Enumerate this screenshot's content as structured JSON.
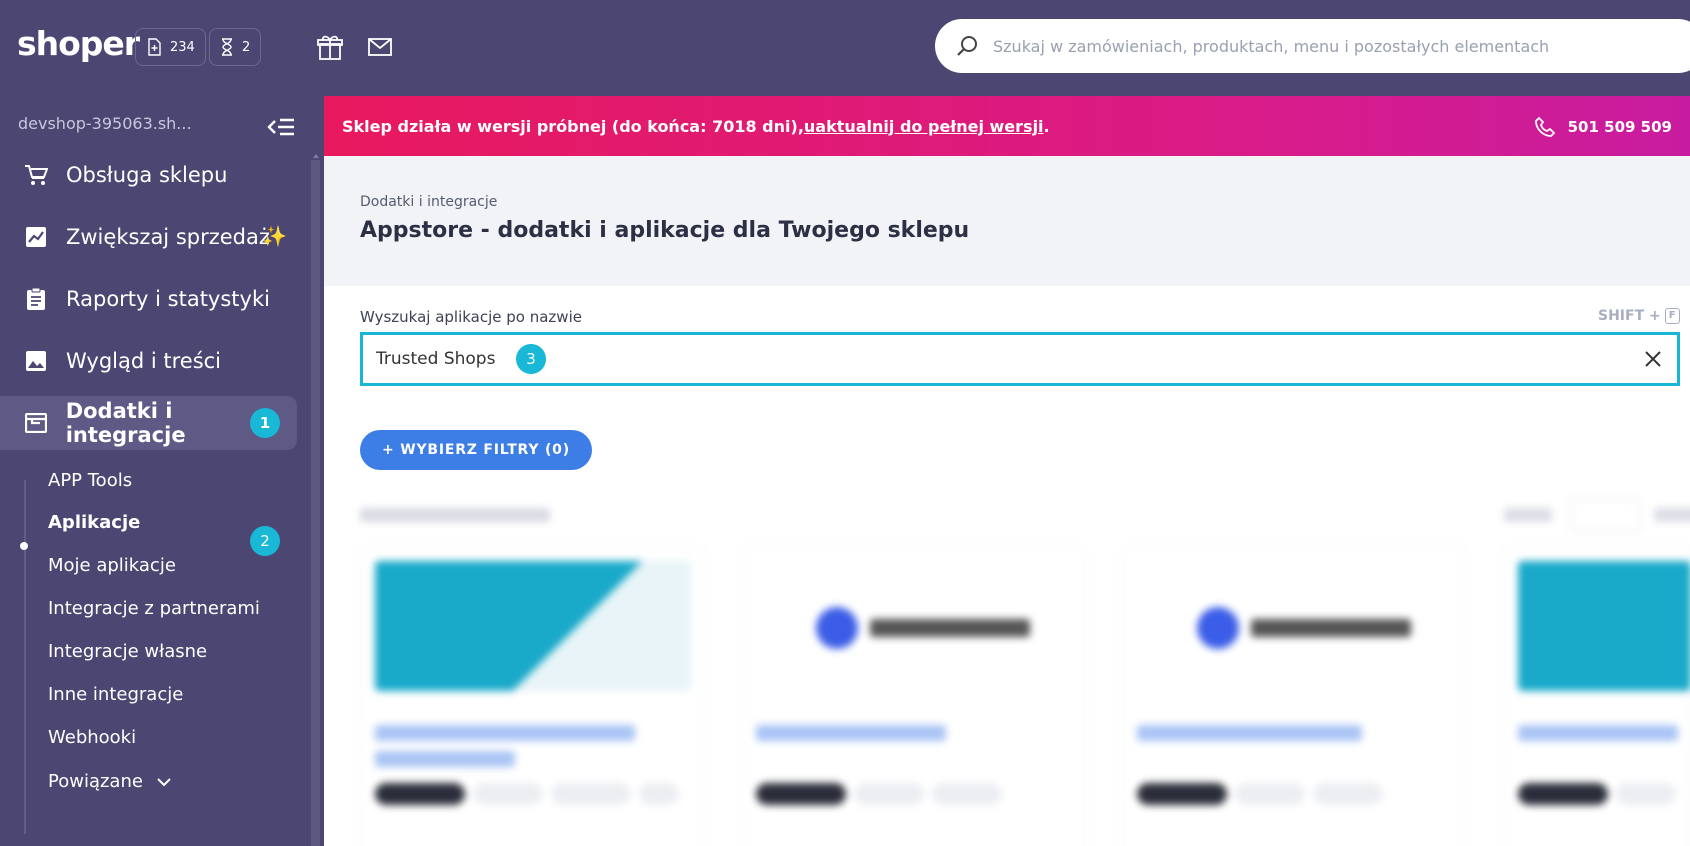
{
  "header": {
    "logo": "shoper",
    "orders_count": "234",
    "pending_count": "2",
    "search_placeholder": "Szukaj w zamówieniach, produktach, menu i pozostałych elementach"
  },
  "sidebar": {
    "shop_name": "devshop-395063.sh...",
    "items": [
      {
        "label": "Obsługa sklepu",
        "icon": "cart-icon"
      },
      {
        "label": "Zwiększaj sprzedaż",
        "icon": "chart-icon"
      },
      {
        "label": "Raporty i statystyki",
        "icon": "clipboard-icon"
      },
      {
        "label": "Wygląd i treści",
        "icon": "image-icon"
      },
      {
        "label": "Dodatki i integracje",
        "icon": "window-icon",
        "badge": "1"
      }
    ],
    "subitems": [
      {
        "label": "APP Tools"
      },
      {
        "label": "Aplikacje",
        "badge": "2"
      },
      {
        "label": "Moje aplikacje"
      },
      {
        "label": "Integracje z partnerami"
      },
      {
        "label": "Integracje własne"
      },
      {
        "label": "Inne integracje"
      },
      {
        "label": "Webhooki"
      },
      {
        "label": "Powiązane"
      }
    ]
  },
  "banner": {
    "text_before": "Sklep działa w wersji próbnej (do końca: 7018 dni), ",
    "link": "uaktualnij do pełnej wersji",
    "text_after": ".",
    "phone": "501 509 509"
  },
  "page": {
    "breadcrumb": "Dodatki i integracje",
    "title": "Appstore - dodatki i aplikacje dla Twojego sklepu"
  },
  "app_search": {
    "label": "Wyszukaj aplikacje po nazwie",
    "shortcut": "SHIFT +",
    "shortcut_key": "F",
    "value": "Trusted Shops",
    "badge": "3"
  },
  "filters": {
    "button_label": "+ WYBIERZ FILTRY (0)"
  },
  "colors": {
    "sidebar_bg": "#4b4672",
    "accent_cyan": "#19b7d5",
    "primary_blue": "#3d7ee6",
    "banner_pink": "#e8195e"
  }
}
